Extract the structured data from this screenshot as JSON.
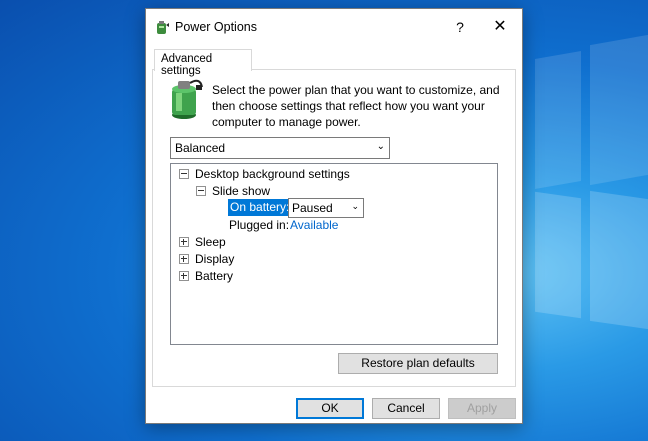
{
  "window": {
    "title": "Power Options",
    "help": "?",
    "close": "✕"
  },
  "tabs": {
    "advanced": "Advanced settings"
  },
  "intro": {
    "line1": "Select the power plan that you want to customize, and",
    "line2": "then choose settings that reflect how you want your",
    "line3": "computer to manage power."
  },
  "plan": {
    "selected": "Balanced"
  },
  "tree": {
    "desktop_bg": "Desktop background settings",
    "slide_show": "Slide show",
    "on_battery_label": "On battery:",
    "on_battery_value": "Paused",
    "plugged_in_label": "Plugged in:",
    "plugged_in_value": "Available",
    "sleep": "Sleep",
    "display": "Display",
    "battery": "Battery"
  },
  "buttons": {
    "restore": "Restore plan defaults",
    "ok": "OK",
    "cancel": "Cancel",
    "apply": "Apply"
  }
}
